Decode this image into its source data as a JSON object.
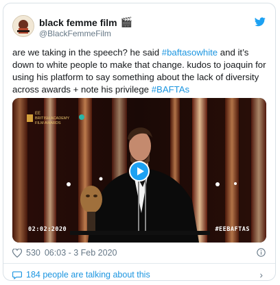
{
  "author": {
    "name": "black femme film",
    "emoji": "🎬",
    "handle": "@BlackFemmeFilm"
  },
  "tweet": {
    "part1": "are we taking in the speech? he said ",
    "hashtag1": "#baftasowhite",
    "part2": " and it’s down to white people to make that change. kudos to joaquin for using his platform to say something about the lack of diversity across awards + note his privilege ",
    "hashtag2": "#BAFTAs"
  },
  "media": {
    "logo_line1": "EE",
    "logo_line2": "BRITISH ACADEMY",
    "logo_line3": "FILM AWARDS",
    "time_overlay": "02:02:2020",
    "hashtag_overlay": "#EEBAFTAS"
  },
  "footer": {
    "likes": "530",
    "datetime": "06:03 - 3 Feb 2020"
  },
  "talking": {
    "label": "184 people are talking about this"
  },
  "colors": {
    "link": "#1b95e0",
    "twitter_blue": "#1da1f2",
    "muted": "#657786"
  }
}
